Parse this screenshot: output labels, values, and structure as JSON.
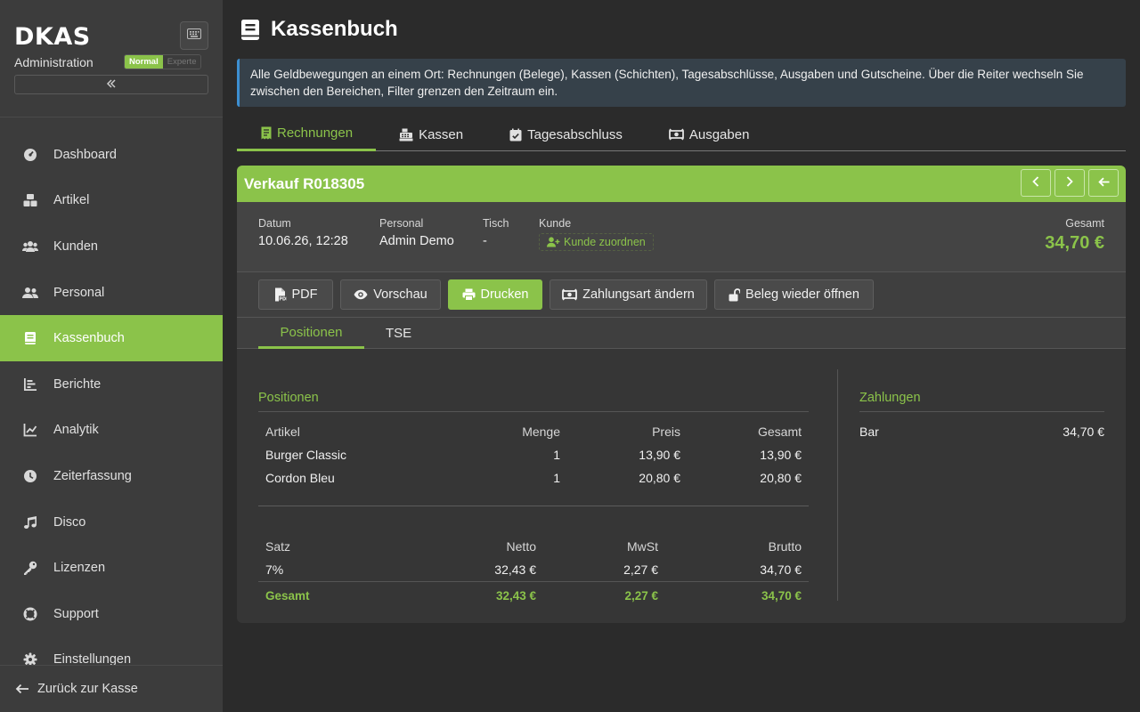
{
  "app": {
    "logo": "DKAS",
    "subtitle": "Administration",
    "mode_normal": "Normal",
    "mode_expert": "Experte",
    "accent": "#8bc34a",
    "info_accent": "#3d8fd1"
  },
  "sidebar": {
    "items": [
      {
        "label": "Dashboard",
        "icon": "dashboard-icon"
      },
      {
        "label": "Artikel",
        "icon": "boxes-icon"
      },
      {
        "label": "Kunden",
        "icon": "users-icon"
      },
      {
        "label": "Personal",
        "icon": "user-group-icon"
      },
      {
        "label": "Kassenbuch",
        "icon": "book-icon",
        "active": true
      },
      {
        "label": "Berichte",
        "icon": "bar-chart-icon"
      },
      {
        "label": "Analytik",
        "icon": "line-chart-icon"
      },
      {
        "label": "Zeiterfassung",
        "icon": "clock-icon"
      },
      {
        "label": "Disco",
        "icon": "music-icon"
      },
      {
        "label": "Lizenzen",
        "icon": "key-icon"
      },
      {
        "label": "Support",
        "icon": "lifebuoy-icon"
      },
      {
        "label": "Einstellungen",
        "icon": "gear-icon"
      }
    ],
    "footer": "Zurück zur Kasse"
  },
  "page": {
    "title": "Kassenbuch",
    "info": "Alle Geldbewegungen an einem Ort: Rechnungen (Belege), Kassen (Schichten), Tagesabschlüsse, Ausgaben und Gutscheine. Über die Reiter wechseln Sie zwischen den Bereichen, Filter grenzen den Zeitraum ein."
  },
  "tabs": [
    {
      "label": "Rechnungen",
      "active": true
    },
    {
      "label": "Kassen"
    },
    {
      "label": "Tagesabschluss"
    },
    {
      "label": "Ausgaben"
    }
  ],
  "receipt": {
    "title": "Verkauf R018305",
    "datum_label": "Datum",
    "datum": "10.06.26, 12:28",
    "personal_label": "Personal",
    "personal": "Admin Demo",
    "tisch_label": "Tisch",
    "tisch": "-",
    "kunde_label": "Kunde",
    "kunde_action": "Kunde zuordnen",
    "gesamt_label": "Gesamt",
    "gesamt": "34,70 €"
  },
  "actions": {
    "pdf": "PDF",
    "preview": "Vorschau",
    "print": "Drucken",
    "payment": "Zahlungsart ändern",
    "reopen": "Beleg wieder öffnen"
  },
  "subtabs": {
    "positions": "Positionen",
    "tse": "TSE"
  },
  "positions": {
    "title": "Positionen",
    "headers": {
      "artikel": "Artikel",
      "menge": "Menge",
      "preis": "Preis",
      "gesamt": "Gesamt"
    },
    "rows": [
      {
        "artikel": "Burger Classic",
        "menge": "1",
        "preis": "13,90 €",
        "gesamt": "13,90 €"
      },
      {
        "artikel": "Cordon Bleu",
        "menge": "1",
        "preis": "20,80 €",
        "gesamt": "20,80 €"
      }
    ]
  },
  "tax": {
    "headers": {
      "satz": "Satz",
      "netto": "Netto",
      "mwst": "MwSt",
      "brutto": "Brutto"
    },
    "rows": [
      {
        "satz": "7%",
        "netto": "32,43 €",
        "mwst": "2,27 €",
        "brutto": "34,70 €"
      }
    ],
    "total": {
      "label": "Gesamt",
      "netto": "32,43 €",
      "mwst": "2,27 €",
      "brutto": "34,70 €"
    }
  },
  "payments": {
    "title": "Zahlungen",
    "rows": [
      {
        "method": "Bar",
        "amount": "34,70 €"
      }
    ]
  }
}
